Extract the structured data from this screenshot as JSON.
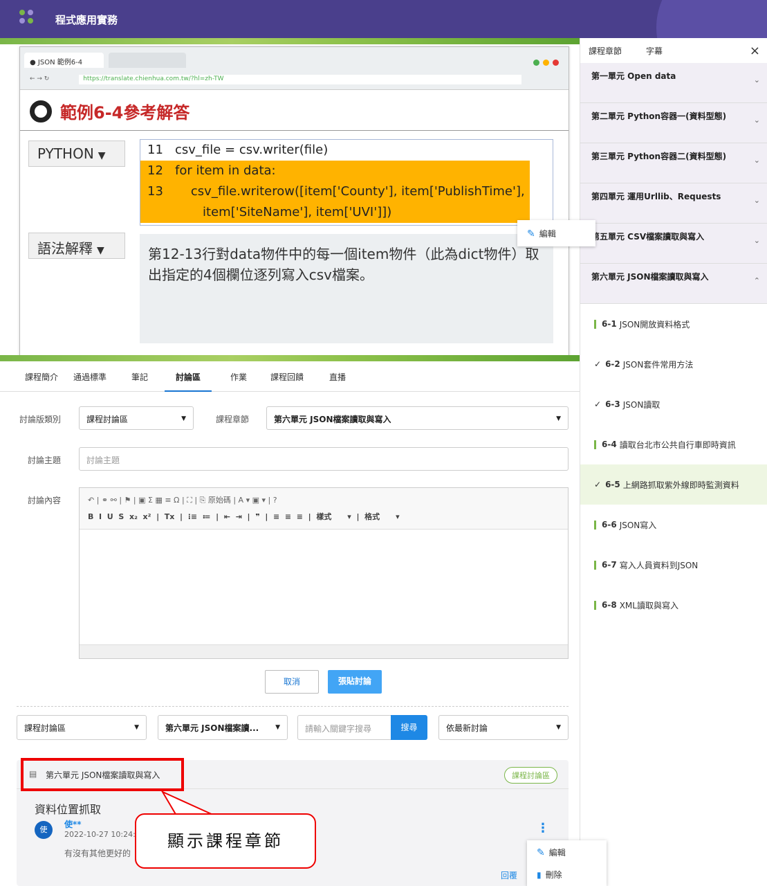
{
  "header": {
    "title": "程式應用實務"
  },
  "video": {
    "browser_tab": "JSON 範例6-4",
    "url": "https://translate.chienhua.com.tw/?hl=zh-TW",
    "slide_title": "範例6-4參考解答",
    "language_select": "PYTHON",
    "code": [
      {
        "num": "11",
        "text": "csv_file = csv.writer(file)",
        "highlight": false
      },
      {
        "num": "12",
        "text": "for item in data:",
        "highlight": true
      },
      {
        "num": "13",
        "text": "    csv_file.writerow([item['County'], item['PublishTime'],",
        "highlight": true
      },
      {
        "num": "",
        "text": "       item['SiteName'], item['UVI']])",
        "highlight": true
      }
    ],
    "syntax_select": "語法解釋",
    "explanation": "第12-13行對data物件中的每一個item物件（此為dict物件）取出指定的4個欄位逐列寫入csv檔案。",
    "edit_popup": "編輯"
  },
  "sidebar": {
    "tabs": [
      "課程章節",
      "字幕"
    ],
    "close": "×",
    "units": [
      "第一單元 Open data",
      "第二單元 Python容器一(資料型態)",
      "第三單元 Python容器二(資料型態)",
      "第四單元 運用Urllib、Requests",
      "第五單元 CSV檔案讀取與寫入",
      "第六單元 JSON檔案讀取與寫入"
    ],
    "lessons": [
      {
        "num": "6-1",
        "title": "JSON開放資料格式",
        "status": "bar"
      },
      {
        "num": "6-2",
        "title": "JSON套件常用方法",
        "status": "check"
      },
      {
        "num": "6-3",
        "title": "JSON讀取",
        "status": "check"
      },
      {
        "num": "6-4",
        "title": "讀取台北市公共自行車即時資訊",
        "status": "bar"
      },
      {
        "num": "6-5",
        "title": "上網路抓取紫外線即時監測資料",
        "status": "check"
      },
      {
        "num": "6-6",
        "title": "JSON寫入",
        "status": "bar"
      },
      {
        "num": "6-7",
        "title": "寫入人員資料到JSON",
        "status": "bar"
      },
      {
        "num": "6-8",
        "title": "XML讀取與寫入",
        "status": "bar"
      }
    ]
  },
  "course_tabs": [
    "課程簡介",
    "通過標準",
    "筆記",
    "討論區",
    "作業",
    "課程回饋",
    "直播"
  ],
  "form": {
    "category_label": "討論版類別",
    "category_value": "課程討論區",
    "chapter_label": "課程章節",
    "chapter_value": "第六單元 JSON檔案讀取與寫入",
    "topic_label": "討論主題",
    "topic_placeholder": "討論主題",
    "content_label": "討論內容",
    "toolbar_row1": "↶ | ⚭ ⚯ | ⚑ | ▣ Σ ▦ ≡ Ω | ⛶ | ⎘ 原始碼 | A ▾ ▣ ▾ | ?",
    "toolbar_row2": "B  I  U  S  x₂  x²  |  Tx  |  ⁝≡  ≔  |  ⇤  ⇥  |  ❞  |  ≡  ≡  ≡  |  樣式      ▾  |  格式      ▾",
    "cancel": "取消",
    "submit": "張貼討論"
  },
  "filters": {
    "category": "課程討論區",
    "chapter": "第六單元 JSON檔案讀...",
    "search_placeholder": "請輸入關鍵字搜尋",
    "search_button": "搜尋",
    "sort": "依最新討論"
  },
  "post": {
    "chapter": "第六單元 JSON檔案讀取與寫入",
    "badge": "課程討論區",
    "title": "資料位置抓取",
    "avatar": "使",
    "author": "使**",
    "time": "2022-10-27 10:24:34",
    "body": "有沒有其他更好的",
    "reply": "回覆",
    "menu_edit": "編輯",
    "menu_delete": "刪除"
  },
  "callout": "顯示課程章節",
  "colors": {
    "header": "#4a3f8c",
    "accent": "#1e88e5",
    "highlight": "#ffb300",
    "annotation": "#e00000"
  }
}
